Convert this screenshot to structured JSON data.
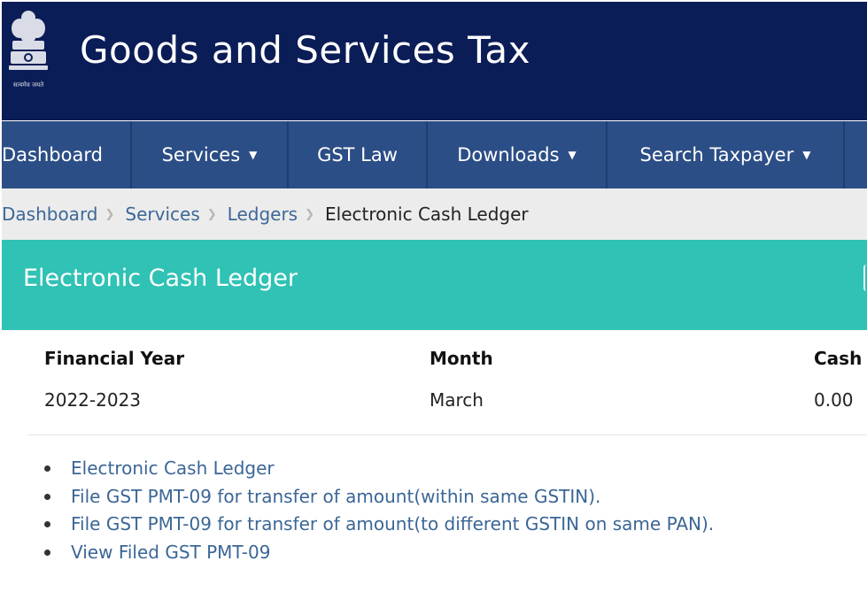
{
  "header": {
    "title": "Goods and Services Tax",
    "emblem_caption": "सत्यमेव जयते",
    "background_color": "#0b1d57"
  },
  "nav": {
    "items": [
      {
        "label": "Dashboard",
        "has_dropdown": false
      },
      {
        "label": "Services",
        "has_dropdown": true
      },
      {
        "label": "GST Law",
        "has_dropdown": false
      },
      {
        "label": "Downloads",
        "has_dropdown": true
      },
      {
        "label": "Search Taxpayer",
        "has_dropdown": true
      }
    ],
    "dropdown_icon": "caret-down-icon",
    "background_color": "#2c4e86"
  },
  "breadcrumb": {
    "items": [
      "Dashboard",
      "Services",
      "Ledgers"
    ],
    "current": "Electronic Cash Ledger",
    "separator_icon": "chevron-right-icon"
  },
  "section": {
    "title": "Electronic Cash Ledger",
    "background_color": "#2fc2b5"
  },
  "table": {
    "headers": [
      "Financial Year",
      "Month",
      "Cash"
    ],
    "rows": [
      [
        "2022-2023",
        "March",
        "0.00"
      ]
    ]
  },
  "links": [
    "Electronic Cash Ledger",
    "File GST PMT-09 for transfer of amount(within same GSTIN).",
    "File GST PMT-09 for transfer of amount(to different GSTIN on same PAN).",
    "View Filed GST PMT-09"
  ]
}
